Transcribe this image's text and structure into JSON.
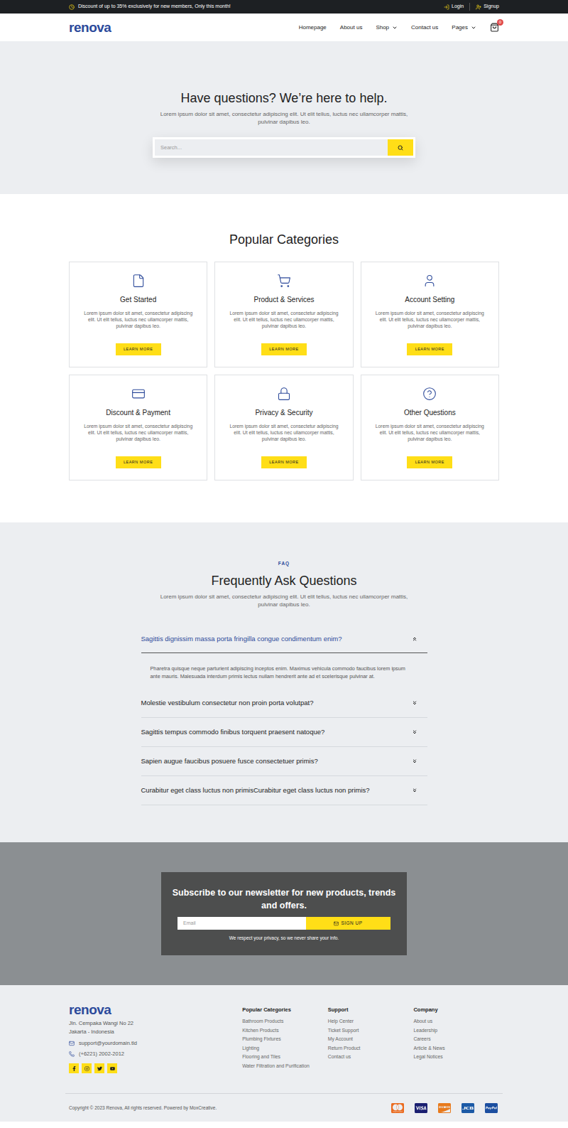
{
  "topbar": {
    "promo": "Discount of up to 35% exclusively for new members, Only this month!",
    "links": [
      "Login",
      "Signup"
    ]
  },
  "nav": {
    "logo": "renova",
    "links": [
      {
        "label": "Homepage",
        "dropdown": false
      },
      {
        "label": "About us",
        "dropdown": false
      },
      {
        "label": "Shop",
        "dropdown": true
      },
      {
        "label": "Contact us",
        "dropdown": false
      },
      {
        "label": "Pages",
        "dropdown": true
      }
    ],
    "cart_count": "0"
  },
  "hero": {
    "title": "Have questions? We’re here to help.",
    "text": "Lorem ipsum dolor sit amet, consectetur adipiscing elit. Ut elit tellus, luctus nec ullamcorper mattis, pulvinar dapibus leo.",
    "search_placeholder": "Search..."
  },
  "categories": {
    "title": "Popular Categories",
    "items": [
      {
        "title": "Get Started",
        "text": "Lorem ipsum dolor sit amet, consectetur adipiscing elit. Ut elit tellus, luctus nec ullamcorper mattis, pulvinar dapibus leo.",
        "button": "LEARN MORE"
      },
      {
        "title": "Product & Services",
        "text": "Lorem ipsum dolor sit amet, consectetur adipiscing elit. Ut elit tellus, luctus nec ullamcorper mattis, pulvinar dapibus leo.",
        "button": "LEARN MORE"
      },
      {
        "title": "Account Setting",
        "text": "Lorem ipsum dolor sit amet, consectetur adipiscing elit. Ut elit tellus, luctus nec ullamcorper mattis, pulvinar dapibus leo.",
        "button": "LEARN MORE"
      },
      {
        "title": "Discount & Payment",
        "text": "Lorem ipsum dolor sit amet, consectetur adipiscing elit. Ut elit tellus, luctus nec ullamcorper mattis, pulvinar dapibus leo.",
        "button": "LEARN MORE"
      },
      {
        "title": "Privacy & Security",
        "text": "Lorem ipsum dolor sit amet, consectetur adipiscing elit. Ut elit tellus, luctus nec ullamcorper mattis, pulvinar dapibus leo.",
        "button": "LEARN MORE"
      },
      {
        "title": "Other Questions",
        "text": "Lorem ipsum dolor sit amet, consectetur adipiscing elit. Ut elit tellus, luctus nec ullamcorper mattis, pulvinar dapibus leo.",
        "button": "LEARN MORE"
      }
    ]
  },
  "faq": {
    "eyebrow": "FAQ",
    "title": "Frequently Ask Questions",
    "text": "Lorem ipsum dolor sit amet, consectetur adipiscing elit. Ut elit tellus, luctus nec ullamcorper mattis, pulvinar dapibus leo.",
    "items": [
      {
        "question": "Sagittis dignissim massa porta fringilla congue condimentum enim?",
        "answer": "Pharetra quisque neque parturient adipiscing inceptos enim. Maximus vehicula commodo faucibus lorem ipsum ante mauris. Malesuada interdum primis lectus nullam hendrerit ante ad et scelerisque pulvinar at.",
        "expanded": true
      },
      {
        "question": "Molestie vestibulum consectetur non proin porta volutpat?",
        "expanded": false
      },
      {
        "question": "Sagittis tempus commodo finibus torquent praesent natoque?",
        "expanded": false
      },
      {
        "question": "Sapien augue faucibus posuere fusce consectetuer primis?",
        "expanded": false
      },
      {
        "question": "Curabitur eget class luctus non primisCurabitur eget class luctus non primis?",
        "expanded": false
      }
    ]
  },
  "newsletter": {
    "title": "Subscribe to our newsletter for new products, trends and offers.",
    "email_placeholder": "Email",
    "button": "SIGN UP",
    "note": "We respect your privacy, so we never share your info."
  },
  "footer": {
    "logo": "renova",
    "address": [
      "Jln. Cempaka Wangi No 22",
      "Jakarta - Indonesia"
    ],
    "email": "support@yourdomain.tld",
    "phone": "(+6221) 2002-2012",
    "columns": [
      {
        "title": "Popular Categories",
        "links": [
          "Bathroom Products",
          "Kitchen Products",
          "Plumbing Fixtures",
          "Lighting",
          "Flooring and Tiles",
          "Water Filtration and Purification"
        ]
      },
      {
        "title": "Support",
        "links": [
          "Help Center",
          "Ticket Support",
          "My Account",
          "Return Product",
          "Contact us"
        ]
      },
      {
        "title": "Company",
        "links": [
          "About us",
          "Leadership",
          "Careers",
          "Article & News",
          "Legal Notices"
        ]
      }
    ],
    "copyright": "Copyright © 2023 Renova, All rights reserved. Powered by MoxCreative."
  }
}
